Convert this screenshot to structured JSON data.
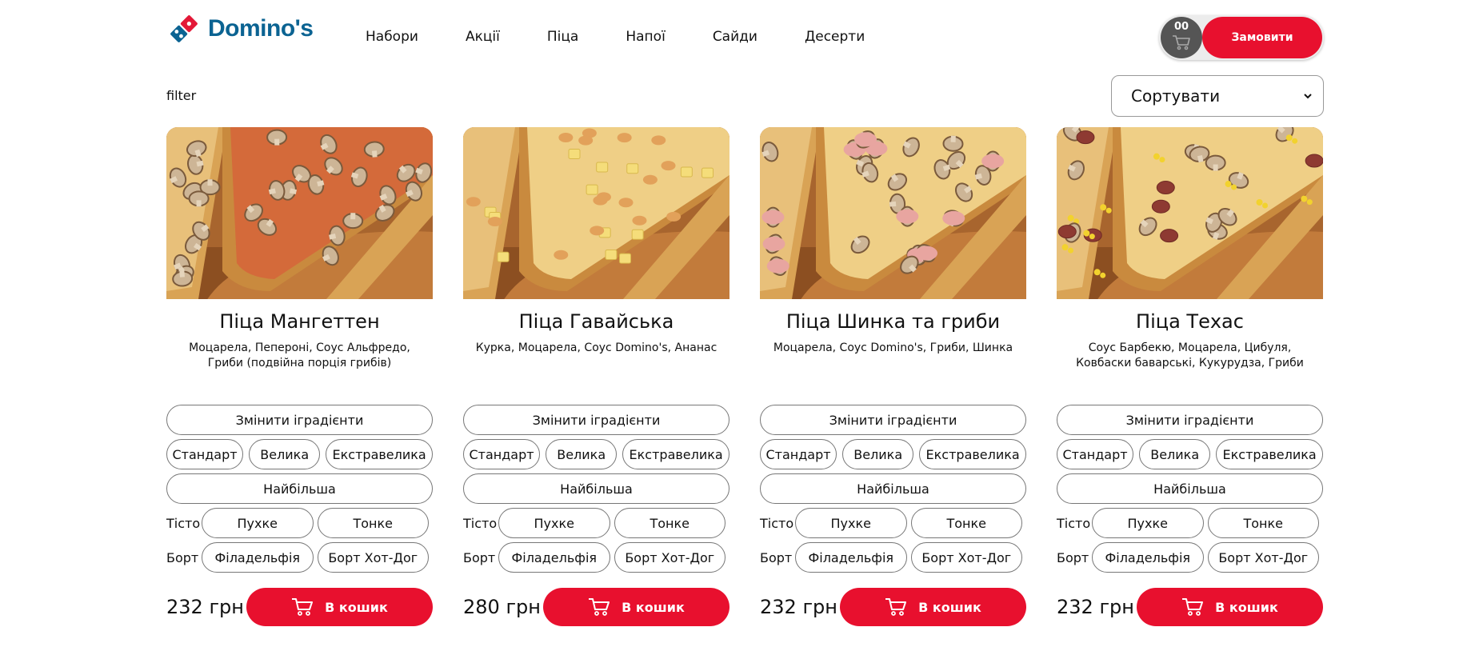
{
  "brand": {
    "name": "Domino's",
    "colors": {
      "blue": "#0b6392",
      "red": "#e31837",
      "accent": "#e8102e"
    }
  },
  "nav": [
    "Набори",
    "Акції",
    "Піца",
    "Напої",
    "Сайди",
    "Десерти"
  ],
  "cart": {
    "count": "00",
    "icon": "cart-icon",
    "order_label": "Замовити"
  },
  "filter": {
    "label": "filter"
  },
  "sort": {
    "selected": "Сортувати"
  },
  "labels": {
    "change_ingredients": "Змінити іградієнти",
    "sizes": [
      "Стандарт",
      "Велика",
      "Екстравелика",
      "Найбільша"
    ],
    "dough_label": "Тісто",
    "dough_options": [
      "Пухке",
      "Тонке"
    ],
    "crust_label": "Борт",
    "crust_options": [
      "Філадельфія",
      "Борт Хот-Дог"
    ],
    "add_to_cart": "В кошик"
  },
  "products": [
    {
      "title": "Піца Мангеттен",
      "description": "Моцарела, Пепероні, Соус Альфредо, Гриби (подвійна порція грибів)",
      "price": "232 грн",
      "toppings": "mushroom"
    },
    {
      "title": "Піца Гавайська",
      "description": "Курка, Моцарела, Соус Domino's, Ананас",
      "price": "280 грн",
      "toppings": "pineapple"
    },
    {
      "title": "Піца Шинка та гриби",
      "description": "Моцарела, Соус Domino's, Гриби, Шинка",
      "price": "232 грн",
      "toppings": "ham"
    },
    {
      "title": "Піца Техас",
      "description": "Соус Барбекю, Моцарела, Цибуля, Ковбаски баварські, Кукурудза, Гриби",
      "price": "232 грн",
      "toppings": "texas"
    }
  ]
}
